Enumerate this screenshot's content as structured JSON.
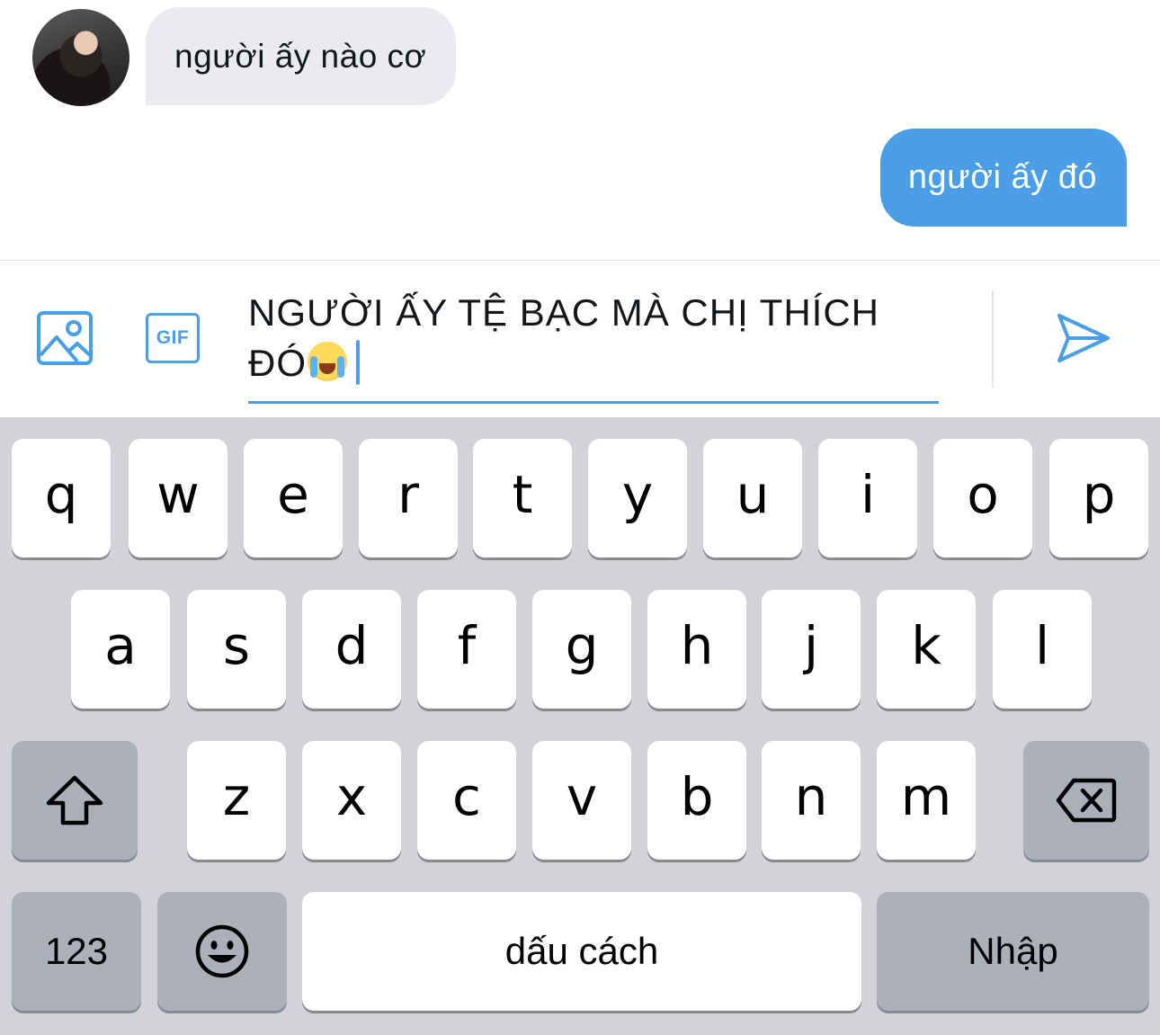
{
  "messages": {
    "incoming": "người ấy nào cơ",
    "outgoing": "người ấy đó"
  },
  "composer": {
    "text": "NGƯỜI ẤY TỆ BẠC MÀ CHỊ THÍCH\nĐÓ",
    "gif_label": "GIF",
    "emoji_icon": "loudly-crying-face-emoji",
    "accent_color": "#4a9ee8"
  },
  "keyboard": {
    "row1": [
      "q",
      "w",
      "e",
      "r",
      "t",
      "y",
      "u",
      "i",
      "o",
      "p"
    ],
    "row2": [
      "a",
      "s",
      "d",
      "f",
      "g",
      "h",
      "j",
      "k",
      "l"
    ],
    "row3": [
      "z",
      "x",
      "c",
      "v",
      "b",
      "n",
      "m"
    ],
    "numbers_label": "123",
    "space_label": "dấu cách",
    "return_label": "Nhập",
    "shift_icon": "shift-icon",
    "backspace_icon": "backspace-icon",
    "emoji_icon": "emoji-icon"
  }
}
